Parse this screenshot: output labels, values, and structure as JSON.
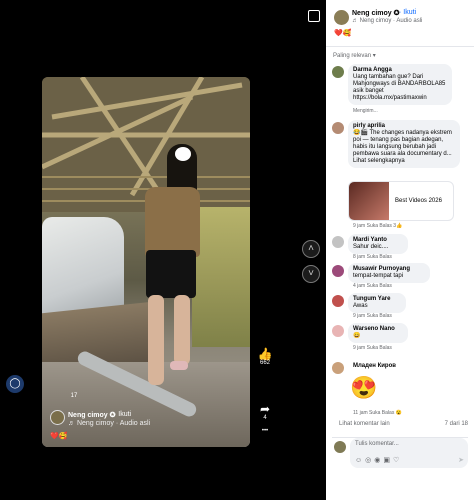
{
  "video": {
    "author_name": "Neng cimoy ✪",
    "follow": "· Ikuti",
    "audio": "♬ Neng cimoy · Audio asli",
    "emoji_line": "❤️🥰"
  },
  "actions": {
    "likes": "662",
    "comments": "17",
    "shares": "4",
    "more": "•••"
  },
  "panel": {
    "author_name": "Neng cimoy ✪",
    "follow": "· Ikuti",
    "audio": "♬ Neng cimoy · Audio asli",
    "emoji_line": "❤️🥰",
    "sort_label": "Paling relevan ▾"
  },
  "comments": [
    {
      "name": "Darma Angga",
      "text": "Uang tambahan gue? Dari Mahjongways di BANDARBOLA85 asik banget https://bola.mx/pastimaxwin",
      "meta": "Mengirim..."
    },
    {
      "name": "pirly aprilia",
      "text": "😂🎬 The changes nadanya ekstrem poi — tenang pas bagian adegan, habis itu langsung berubah jadi pembawa suara ala documentary d... Lihat selengkapnya",
      "meta": "9 jam   Suka   Balas   3👍",
      "ad_text": "Best Videos 2026"
    },
    {
      "name": "Mardi Yanto",
      "text": "Sahur deic....",
      "meta": "8 jam   Suka   Balas"
    },
    {
      "name": "Musawir Purnoyang",
      "text": "tempat-tempat tapi",
      "meta": "4 jam   Suka   Balas"
    },
    {
      "name": "Tungum Yare",
      "text": "Awas",
      "meta": "9 jam   Suka   Balas"
    },
    {
      "name": "Warseno Nano",
      "text": "😄",
      "meta": "9 jam   Suka   Balas"
    },
    {
      "name": "Младен Киров",
      "text": "",
      "meta": "11 jam   Suka   Balas   😮",
      "emoji": "😍"
    }
  ],
  "footer": {
    "more_comments": "Lihat komentar lain",
    "count": "7 dari 18",
    "input_placeholder": "Tulis komentar...",
    "tools": "☺◎◉▣♡",
    "send": "➤"
  }
}
